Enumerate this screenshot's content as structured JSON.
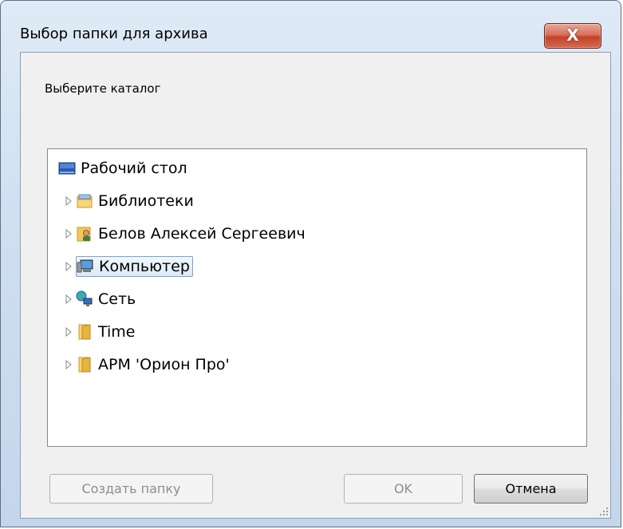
{
  "window": {
    "title": "Выбор папки для архива",
    "close_label": "X"
  },
  "dialog": {
    "prompt": "Выберите каталог"
  },
  "tree": {
    "items": [
      {
        "label": "Рабочий стол",
        "icon": "desktop-icon",
        "expandable": false
      },
      {
        "label": "Библиотеки",
        "icon": "libraries-icon",
        "expandable": true
      },
      {
        "label": "Белов Алексей Сергеевич",
        "icon": "user-folder-icon",
        "expandable": true
      },
      {
        "label": "Компьютер",
        "icon": "computer-icon",
        "expandable": true,
        "selected": true
      },
      {
        "label": "Сеть",
        "icon": "network-icon",
        "expandable": true
      },
      {
        "label": "Time",
        "icon": "folder-icon",
        "expandable": true
      },
      {
        "label": "АРМ 'Орион Про'",
        "icon": "folder-icon",
        "expandable": true
      }
    ]
  },
  "buttons": {
    "new_folder": "Создать папку",
    "ok": "OK",
    "cancel": "Отмена"
  },
  "colors": {
    "close_button": "#c2422a",
    "selection_border": "#7da2ce",
    "frame": "#c4d6ec"
  }
}
